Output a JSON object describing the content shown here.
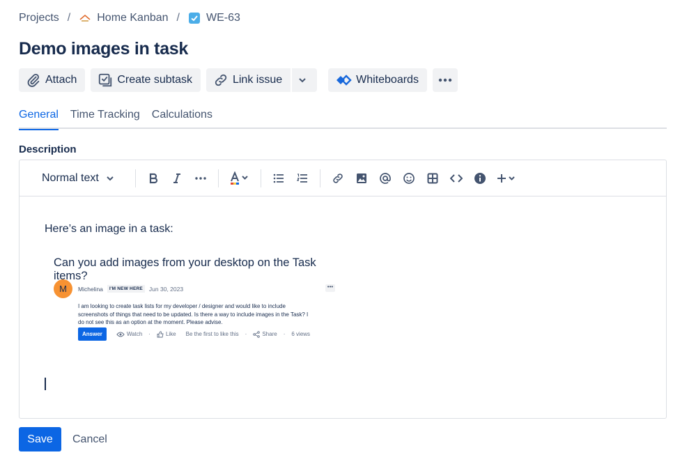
{
  "breadcrumb": {
    "projects": "Projects",
    "separator": "/",
    "project_name": "Home Kanban",
    "issue_key": "WE-63"
  },
  "page_title": "Demo images in task",
  "toolbar": {
    "attach": "Attach",
    "create_subtask": "Create subtask",
    "link_issue": "Link issue",
    "whiteboards": "Whiteboards"
  },
  "tabs": [
    {
      "label": "General",
      "active": true
    },
    {
      "label": "Time Tracking",
      "active": false
    },
    {
      "label": "Calculations",
      "active": false
    }
  ],
  "description_label": "Description",
  "editor": {
    "text_style": "Normal text",
    "paragraph": "Here’s an image in a task:",
    "embed": {
      "title": "Can you add images from your desktop on the Task items?",
      "avatar_letter": "M",
      "author": "Michelina",
      "badge": "I'M NEW HERE",
      "date": "Jun 30, 2023",
      "body": "I am looking to create task lists for my developer / designer and would like to include screenshots of things that need to be updated. Is there a way to include images in the Task? I do not see this as an option at the moment. Please advise.",
      "answer": "Answer",
      "watch": "Watch",
      "like": "Like",
      "first_like": "Be the first to like this",
      "share": "Share",
      "views": "6 views"
    }
  },
  "footer": {
    "save": "Save",
    "cancel": "Cancel"
  },
  "colors": {
    "primary": "#0c66e4",
    "text": "#172b4d",
    "subtle_text": "#44546f",
    "button_bg": "#f1f2f4",
    "avatar": "#f79232"
  }
}
